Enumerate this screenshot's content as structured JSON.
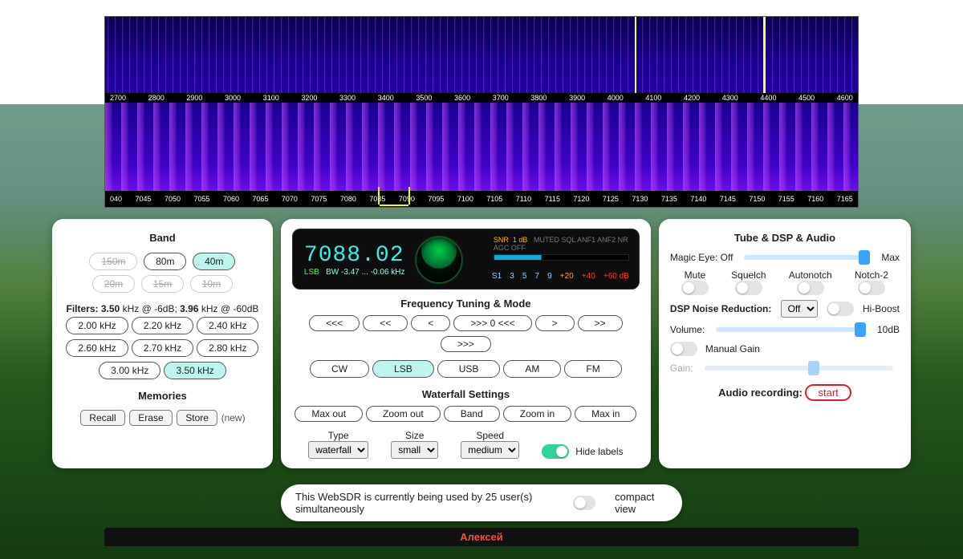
{
  "scale_top": [
    "2700",
    "2800",
    "2900",
    "3000",
    "3100",
    "3200",
    "3300",
    "3400",
    "3500",
    "3600",
    "3700",
    "3800",
    "3900",
    "4000",
    "4100",
    "4200",
    "4300",
    "4400",
    "4500",
    "4600"
  ],
  "scale_bottom": [
    "040",
    "7045",
    "7050",
    "7055",
    "7060",
    "7065",
    "7070",
    "7075",
    "7080",
    "7085",
    "7090",
    "7095",
    "7100",
    "7105",
    "7110",
    "7115",
    "7120",
    "7125",
    "7130",
    "7135",
    "7140",
    "7145",
    "7150",
    "7155",
    "7160",
    "7165"
  ],
  "band": {
    "title": "Band",
    "b150": "150m",
    "b80": "80m",
    "b40": "40m",
    "b20": "20m",
    "b15": "15m",
    "b10": "10m"
  },
  "filters": {
    "lead": "Filters:",
    "v1": "3.50",
    "u1": "kHz @ -6dB;",
    "v2": "3.96",
    "u2": "kHz @ -60dB",
    "opts": [
      "2.00 kHz",
      "2.20 kHz",
      "2.40 kHz",
      "2.60 kHz",
      "2.70 kHz",
      "2.80 kHz",
      "3.00 kHz",
      "3.50 kHz"
    ]
  },
  "memories": {
    "title": "Memories",
    "recall": "Recall",
    "erase": "Erase",
    "store": "Store",
    "note": "(new)"
  },
  "display": {
    "freq": "7088.02",
    "mode": "LSB",
    "bw": "BW  -3.47 ... -0.06 kHz",
    "snr_label": "SNR",
    "snr_val": "1 dB",
    "flags": "MUTED   SQL   ANF1   ANF2   NR   AGC OFF",
    "s_scale": [
      "S1",
      "3",
      "5",
      "7",
      "9"
    ],
    "p20": "+20",
    "p40": "+40",
    "p60": "+60 dB"
  },
  "tuning": {
    "title": "Frequency Tuning & Mode",
    "btns": [
      "<<<",
      "<<",
      "<",
      ">>> 0 <<<",
      ">",
      ">>",
      ">>>"
    ],
    "modes": [
      "CW",
      "LSB",
      "USB",
      "AM",
      "FM"
    ]
  },
  "wf": {
    "title": "Waterfall Settings",
    "btns": [
      "Max out",
      "Zoom out",
      "Band",
      "Zoom in",
      "Max in"
    ],
    "type_label": "Type",
    "size_label": "Size",
    "speed_label": "Speed",
    "type": "waterfall",
    "size": "small",
    "speed": "medium",
    "hide": "Hide labels"
  },
  "right": {
    "title": "Tube & DSP & Audio",
    "magic": "Magic Eye: Off",
    "max": "Max",
    "mute": "Mute",
    "squelch": "Squelch",
    "autonotch": "Autonotch",
    "notch2": "Notch-2",
    "dsp": "DSP Noise Reduction:",
    "dsp_val": "Off",
    "hiboost": "Hi-Boost",
    "volume": "Volume:",
    "vol_val": "10dB",
    "manual": "Manual Gain",
    "gain": "Gain:",
    "rec": "Audio recording:",
    "start": "start"
  },
  "footer": {
    "msg": "This WebSDR is currently being used by 25 user(s) simultaneously",
    "compact": "compact view"
  },
  "name": "Алексей"
}
